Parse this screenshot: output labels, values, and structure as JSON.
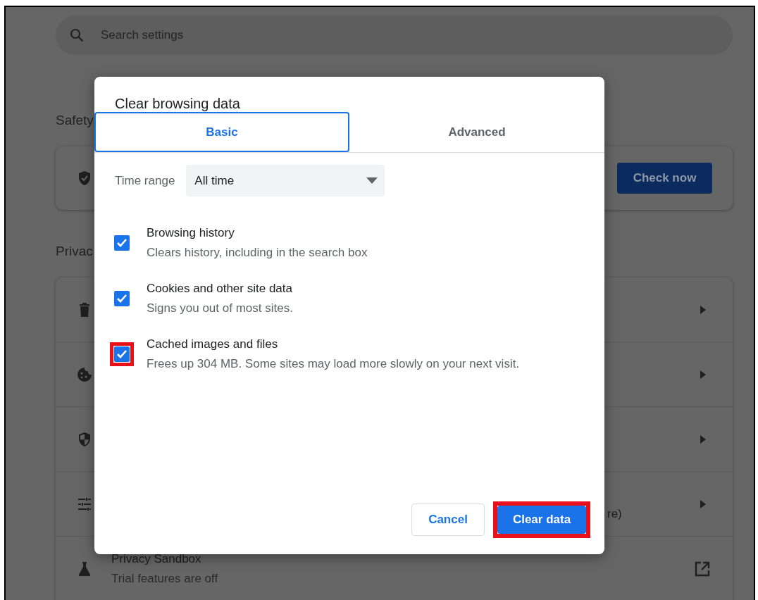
{
  "settings_page": {
    "search": {
      "placeholder": "Search settings"
    },
    "safety": {
      "heading": "Safety",
      "card": {
        "button": "Check now"
      }
    },
    "privacy": {
      "heading": "Privac",
      "rows": [
        {
          "kind": "link"
        },
        {
          "kind": "link"
        },
        {
          "kind": "link"
        },
        {
          "kind": "link",
          "partial_text": "re)"
        },
        {
          "kind": "external",
          "title": "Privacy Sandbox",
          "subtitle": "Trial features are off"
        }
      ]
    }
  },
  "dialog": {
    "title": "Clear browsing data",
    "tabs": [
      {
        "label": "Basic",
        "selected": true
      },
      {
        "label": "Advanced",
        "selected": false
      }
    ],
    "time_range": {
      "label": "Time range",
      "value": "All time"
    },
    "options": [
      {
        "title": "Browsing history",
        "description": "Clears history, including in the search box",
        "checked": true,
        "highlighted": false
      },
      {
        "title": "Cookies and other site data",
        "description": "Signs you out of most sites.",
        "checked": true,
        "highlighted": false
      },
      {
        "title": "Cached images and files",
        "description": "Frees up 304 MB. Some sites may load more slowly on your next visit.",
        "checked": true,
        "highlighted": true
      }
    ],
    "buttons": [
      {
        "label": "Cancel",
        "kind": "secondary",
        "highlighted": false
      },
      {
        "label": "Clear data",
        "kind": "primary",
        "highlighted": true
      }
    ]
  }
}
